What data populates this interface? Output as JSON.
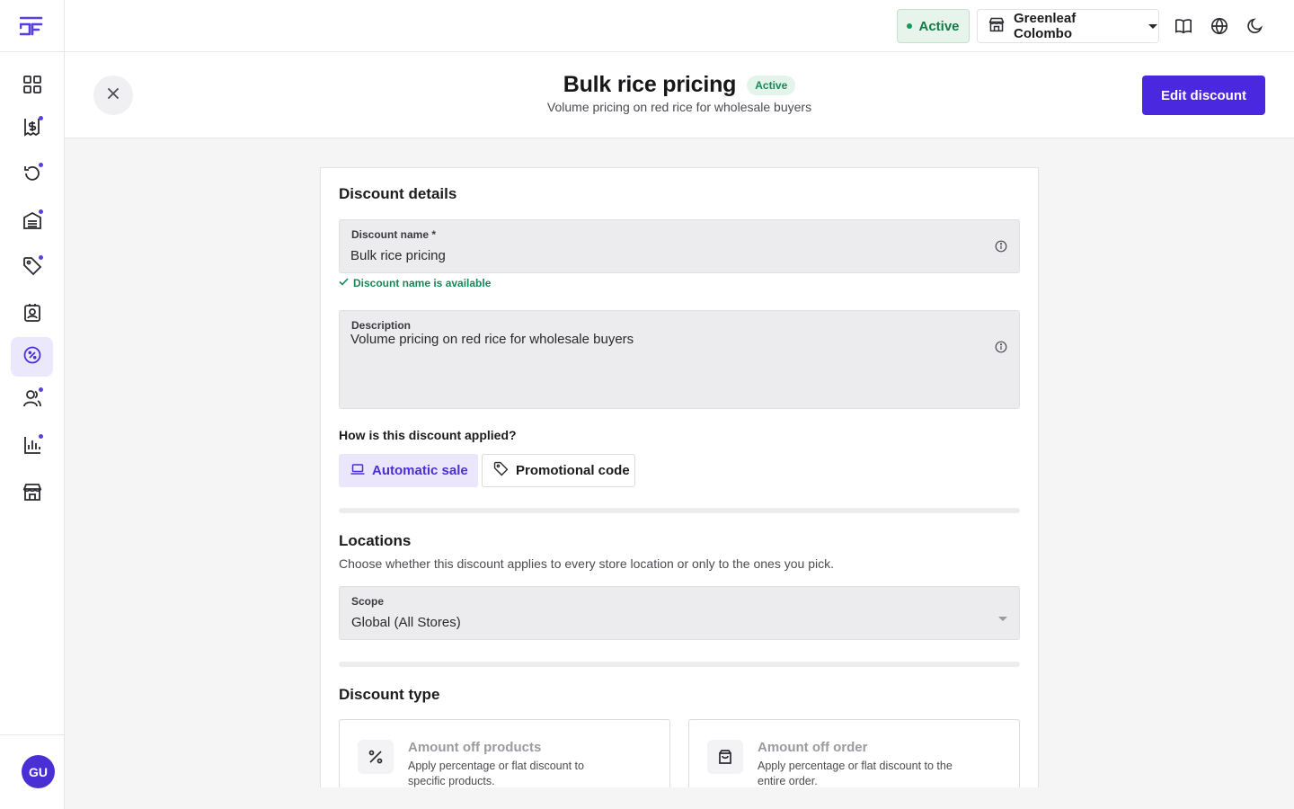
{
  "app": {
    "logo_icon": "sf-logo-icon",
    "accent": "#4a28e0"
  },
  "sidebar": {
    "items": [
      {
        "icon": "dashboard-grid-icon",
        "dot": false,
        "active": false
      },
      {
        "icon": "dollar-receipt-icon",
        "dot": true,
        "active": false
      },
      {
        "icon": "refresh-history-icon",
        "dot": true,
        "active": false
      },
      {
        "icon": "inventory-icon",
        "dot": true,
        "active": false
      },
      {
        "icon": "tag-icon",
        "dot": true,
        "active": false
      },
      {
        "icon": "contact-book-icon",
        "dot": false,
        "active": false
      },
      {
        "icon": "discount-badge-icon",
        "dot": false,
        "active": true
      },
      {
        "icon": "users-icon",
        "dot": true,
        "active": false
      },
      {
        "icon": "reports-chart-icon",
        "dot": true,
        "active": false
      },
      {
        "icon": "store-icon",
        "dot": false,
        "active": false
      }
    ],
    "avatar_initials": "GU"
  },
  "topbar": {
    "status": "Active",
    "store_name": "Greenleaf Colombo",
    "icons": [
      "book-icon",
      "globe-icon",
      "moon-icon"
    ]
  },
  "header": {
    "title": "Bulk rice pricing",
    "badge": "Active",
    "subtitle": "Volume pricing on red rice for wholesale buyers",
    "edit_label": "Edit discount"
  },
  "details": {
    "section_title": "Discount details",
    "name_label": "Discount name *",
    "name_value": "Bulk rice pricing",
    "name_valid": "Discount name is available",
    "desc_label": "Description",
    "desc_value": "Volume pricing on red rice for wholesale buyers",
    "applied_question": "How is this discount applied?",
    "options": [
      {
        "label": "Automatic sale",
        "selected": true
      },
      {
        "label": "Promotional code",
        "selected": false
      }
    ]
  },
  "locations": {
    "section_title": "Locations",
    "description": "Choose whether this discount applies to every store location or only to the ones you pick.",
    "scope_label": "Scope",
    "scope_value": "Global (All Stores)"
  },
  "discount_type": {
    "section_title": "Discount type",
    "cards": [
      {
        "icon": "percent-icon",
        "title": "Amount off products",
        "desc": "Apply percentage or flat discount to specific products."
      },
      {
        "icon": "shopping-bag-icon",
        "title": "Amount off order",
        "desc": "Apply percentage or flat discount to the entire order."
      }
    ]
  }
}
